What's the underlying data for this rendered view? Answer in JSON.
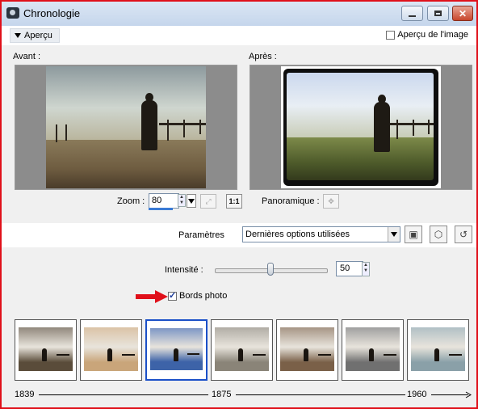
{
  "window": {
    "title": "Chronologie",
    "buttons": [
      "minimize-icon",
      "maximize-icon",
      "close-icon"
    ]
  },
  "topbar": {
    "apercu_label": "Aperçu",
    "image_preview_label": "Aperçu de l'image",
    "image_preview_checked": false
  },
  "preview": {
    "before_label": "Avant :",
    "after_label": "Après :"
  },
  "zoom": {
    "label": "Zoom :",
    "value": "80",
    "fit_icon": "zoom-fit-icon",
    "one_to_one_label": "1:1",
    "pan_label": "Panoramique :",
    "pan_icon": "pan-icon"
  },
  "parameters": {
    "label": "Paramètres",
    "selected": "Dernières options utilisées",
    "buttons": [
      "save-icon",
      "cube-icon",
      "reset-icon"
    ]
  },
  "intensity": {
    "label": "Intensité :",
    "value": "50",
    "level": 0.5
  },
  "photo_borders": {
    "label": "Bords photo",
    "checked": true
  },
  "thumbnails": [
    {
      "name": "thumb-1",
      "tone": "#5a4c3a"
    },
    {
      "name": "thumb-2",
      "tone": "#c9a57a"
    },
    {
      "name": "thumb-3",
      "tone": "#3d63a8"
    },
    {
      "name": "thumb-4",
      "tone": "#8a8478"
    },
    {
      "name": "thumb-5",
      "tone": "#7a6048"
    },
    {
      "name": "thumb-6",
      "tone": "#707070"
    },
    {
      "name": "thumb-7",
      "tone": "#8aa0a8"
    }
  ],
  "timeline": {
    "start": "1839",
    "mid": "1875",
    "end": "1960"
  },
  "colors": {
    "accent": "#e0101a",
    "selection": "#1b50c8"
  }
}
